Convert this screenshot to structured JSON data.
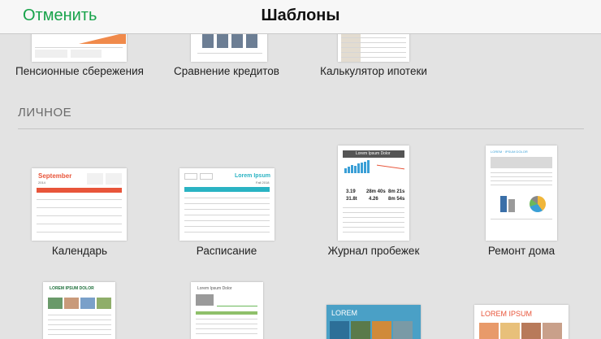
{
  "navbar": {
    "cancel_label": "Отменить",
    "title": "Шаблоны"
  },
  "top_row": [
    {
      "label": "Пенсионные сбережения"
    },
    {
      "label": "Сравнение кредитов"
    },
    {
      "label": "Калькулятор ипотеки"
    }
  ],
  "section": {
    "title": "ЛИЧНОЕ"
  },
  "personal_row1": [
    {
      "label": "Календарь"
    },
    {
      "label": "Расписание"
    },
    {
      "label": "Журнал пробежек"
    },
    {
      "label": "Ремонт дома"
    }
  ],
  "thumb_text": {
    "calendar_month": "September",
    "calendar_year": "2014",
    "schedule_title": "Lorem Ipsum",
    "schedule_sub": "Fall 2018",
    "run_title": "Lorem Ipsum Dolor",
    "run_stats": [
      "3.19",
      "28m 40s",
      "8m 21s",
      "31.8t",
      "4.26",
      "8m 54s"
    ],
    "home_title": "LOREM · IPSUM DOLOR",
    "r3a_title": "LOREM IPSUM DOLOR",
    "r3b_title": "Lorem Ipsum Dolor",
    "r3c_title": "LOREM",
    "r3d_title": "LOREM IPSUM"
  },
  "colors": {
    "accent_green": "#17a34a",
    "calendar_red": "#e8553a",
    "teal": "#2ab3c3",
    "chart_blue": "#3a9fd6"
  }
}
